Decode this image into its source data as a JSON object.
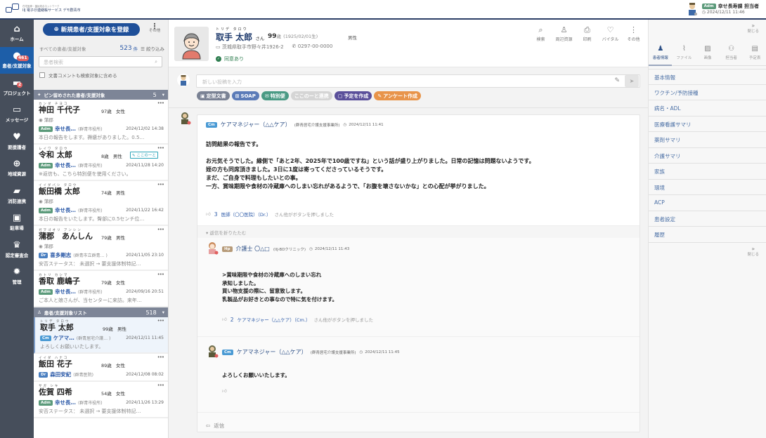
{
  "app": {
    "logo_subtitle": "在宅医療・福祉統合ネットワーク",
    "logo_title": "IIJ 電子＠連絡帳サービス デモ群青市"
  },
  "current_user": {
    "role": "Adm",
    "name": "幸せ長寿課 担当者",
    "timestamp": "2024/12/11 11:46"
  },
  "sidenav": {
    "items": [
      {
        "label": "ホーム",
        "icon": "home-icon",
        "glyph": "⌂"
      },
      {
        "label": "患者/支援対象",
        "icon": "person-icon",
        "glyph": "●",
        "badge": "461",
        "active": true
      },
      {
        "label": "プロジェクト",
        "icon": "folder-icon",
        "glyph": "▬",
        "badge": "2"
      },
      {
        "label": "メッセージ",
        "icon": "message-icon",
        "glyph": "▭"
      },
      {
        "label": "要援護者",
        "icon": "care-hand-icon",
        "glyph": "♥"
      },
      {
        "label": "地域資源",
        "icon": "map-pin-icon",
        "glyph": "⊕"
      },
      {
        "label": "消防連携",
        "icon": "ambulance-icon",
        "glyph": "▰"
      },
      {
        "label": "駐車場",
        "icon": "car-icon",
        "glyph": "▣"
      },
      {
        "label": "認定審査会",
        "icon": "committee-icon",
        "glyph": "♛"
      },
      {
        "label": "管理",
        "icon": "gear-icon",
        "glyph": "✹"
      }
    ]
  },
  "list_panel": {
    "new_button_label": "新規患者/支援対象を登録",
    "more_label": "その他",
    "all_label": "すべての患者/支援対象",
    "total_count": "523",
    "count_unit": "件",
    "filter_label": "絞り込み",
    "search_placeholder": "患者検索",
    "include_comments_label": "文書コメントも検索対象に含める",
    "include_comments_checked": false,
    "pinned_section": {
      "title": "ピン留めされた患者/支援対象",
      "count": "5"
    },
    "list_section": {
      "title": "患者/支援対象リスト",
      "count": "518"
    },
    "pinned": [
      {
        "ruby": "カンダ チヨコ",
        "name": "神田 千代子",
        "age": "97歳",
        "sex": "女性",
        "location": "蒲郡",
        "role": "Adm",
        "author": "幸せ長…",
        "org": "(群青市役所)",
        "date": "2024/12/02 14:38",
        "preview": "本日の報告をします。褥瘡がありました。0.5…"
      },
      {
        "ruby": "レイワ タロウ",
        "name": "令和 太郎",
        "age": "8歳",
        "sex": "男性",
        "tag": "ここのーと",
        "role": "Adm",
        "author": "幸せ長…",
        "org": "(群青市役所)",
        "date": "2024/11/28 14:20",
        "preview": "※返信も、こちら特別便を使用ください。"
      },
      {
        "ruby": "イイダバシ タロウ",
        "name": "飯田橋 太郎",
        "age": "74歳",
        "sex": "男性",
        "location": "蒲郡",
        "role": "Adm",
        "author": "幸せ長…",
        "org": "(群青市役所)",
        "date": "2024/11/22 16:42",
        "preview": "本日の報告をいたします。臀部に0.5センチ位…"
      },
      {
        "ruby": "ガマゴオリ アンシン",
        "name": "蒲郡　あんしん",
        "age": "79歳",
        "sex": "男性",
        "location": "蒲郡",
        "role": "Dr",
        "author": "喜多剛志",
        "org": "(群青市立群青… )",
        "date": "2024/11/05 23:10",
        "preview": "安否ステータス： 未選択 → 要支援体制特記…"
      },
      {
        "ruby": "カトリ カシマ",
        "name": "香取 鹿嶋子",
        "age": "79歳",
        "sex": "女性",
        "role": "Adm",
        "author": "幸せ長…",
        "org": "(群青市役所)",
        "date": "2024/09/16 20:51",
        "preview": "ご本人と娘さんが、当センターに来訪。来年…"
      }
    ],
    "patients": [
      {
        "ruby": "トリデ タロウ",
        "name": "取手 太郎",
        "age": "99歳",
        "sex": "男性",
        "role": "Cm",
        "author": "ケアマ…",
        "org": "(群青居宅介護… )",
        "date": "2024/12/11 11:45",
        "preview": "よろしくお願いいたします。",
        "selected": true
      },
      {
        "ruby": "イイダ ハナコ",
        "name": "飯田 花子",
        "age": "89歳",
        "sex": "女性",
        "role": "Dr",
        "author": "森田安紀",
        "org": "(群青医院)",
        "date": "2024/12/08 08:02",
        "preview": ""
      },
      {
        "ruby": "サガ シキ",
        "name": "佐賀 四希",
        "age": "54歳",
        "sex": "女性",
        "role": "Adm",
        "author": "幸せ長…",
        "org": "(群青市役所)",
        "date": "2024/11/26 13:29",
        "preview": "安否ステータス： 未選択 → 要支援体制特記…"
      }
    ]
  },
  "patient_header": {
    "ruby": "トリデ タロウ",
    "name": "取手 太郎",
    "honorific": "さん",
    "age": "99",
    "age_unit": "歳",
    "birth": "(1925/02/01生)",
    "sex": "男性",
    "address": "茨城県取手市野々井1926-2",
    "phone": "0297-00-0000",
    "consent": "同意あり",
    "actions": [
      {
        "label": "検索",
        "icon": "search-icon",
        "glyph": "⌕"
      },
      {
        "label": "周辺資源",
        "icon": "person-outline-icon",
        "glyph": "♙"
      },
      {
        "label": "印刷",
        "icon": "printer-icon",
        "glyph": "⎙"
      },
      {
        "label": "バイタル",
        "icon": "heart-pulse-icon",
        "glyph": "♡"
      },
      {
        "label": "その他",
        "icon": "more-vertical-icon",
        "glyph": "⋮"
      }
    ]
  },
  "composer": {
    "placeholder": "新しい投稿を入力",
    "chips": [
      {
        "label": "定型文書",
        "color": "#7a8294",
        "glyph": "▣",
        "icon": "template-icon"
      },
      {
        "label": "SOAP",
        "color": "#5b7bb8",
        "glyph": "⊞",
        "icon": "grid-icon"
      },
      {
        "label": "特別便",
        "color": "#4a9a84",
        "glyph": "✉",
        "icon": "mail-icon"
      },
      {
        "label": "ここのーと連携",
        "color": "#d5d5d5",
        "glyph": "",
        "icon": "link-icon",
        "disabled": true
      },
      {
        "label": "予定を作成",
        "color": "#5a4f9a",
        "glyph": "▢",
        "icon": "calendar-icon"
      },
      {
        "label": "アンケート作成",
        "color": "#e8944a",
        "glyph": "✎",
        "icon": "survey-icon"
      }
    ]
  },
  "thread": {
    "main_post": {
      "role": "Cm",
      "author": "ケアマネジャー（△△ケア）",
      "org": "(群青居宅介護支援事業所)",
      "time": "2024/12/11 11:41",
      "lines": [
        "訪問結果の報告です。",
        "",
        "お元気そうでした。縁側で「あと2年、2025年で100歳ですね」という話が盛り上がりました。日常の記憶は問題ないようです。",
        "姪の方も同席頂きました。3日に1度は寄ってくださっているそうです。",
        "まだ、ご自身で料理もしたいとの事。",
        "一方、賞味期限や食材の冷蔵庫へのしまい忘れがあるようで、「お腹を壊さないかな」との心配が挙がりました。"
      ],
      "like_count": "3",
      "like_who": "医師（〇〇医院）（Dr.）",
      "like_suffix": "さん他がボタンを押しました"
    },
    "fold_label": "返信を折りたたむ",
    "replies": [
      {
        "role": "Hp",
        "author": "介護士 〇△□",
        "org": "(IIJ-BDクリニック)",
        "time": "2024/12/11 11:43",
        "lines": [
          ">賞味期限や食材の冷蔵庫へのしまい忘れ",
          "承知しました。",
          "買い物支援の際に、留意致します。",
          "乳製品がお好きとの事なので特に気を付けます。"
        ],
        "like_count": "2",
        "like_who": "ケアマネジャー（△△ケア）（Cm.）",
        "like_suffix": "さん他がボタンを押しました"
      },
      {
        "role": "Cm",
        "author": "ケアマネジャー（△△ケア）",
        "org": "(群青居宅介護支援事業所)",
        "time": "2024/12/11 11:45",
        "lines": [
          "よろしくお願いいたします。"
        ],
        "like_count": "",
        "like_who": "",
        "like_suffix": ""
      }
    ],
    "reply_label": "返信"
  },
  "right_panel": {
    "close_label": "閉じる",
    "tabs": [
      {
        "label": "患者情報",
        "icon": "patient-info-icon",
        "glyph": "♟",
        "active": true
      },
      {
        "label": "ファイル",
        "icon": "paperclip-icon",
        "glyph": "⌇"
      },
      {
        "label": "画像",
        "icon": "image-icon",
        "glyph": "▨"
      },
      {
        "label": "担当者",
        "icon": "people-icon",
        "glyph": "⚇"
      },
      {
        "label": "予定表",
        "icon": "calendar-icon",
        "glyph": "▤"
      }
    ],
    "items": [
      "基本情報",
      "ワクチン/予防接種",
      "病名・ADL",
      "医療看護サマリ",
      "薬剤サマリ",
      "介護サマリ",
      "家族",
      "環境",
      "ACP",
      "患者設定",
      "履歴"
    ]
  },
  "colors": {
    "primary": "#1e4f99",
    "sidenav": "#464e5b",
    "sidenav_active": "#1d5ea8",
    "link": "#2c5aa8",
    "consent": "#2e7d4f"
  }
}
